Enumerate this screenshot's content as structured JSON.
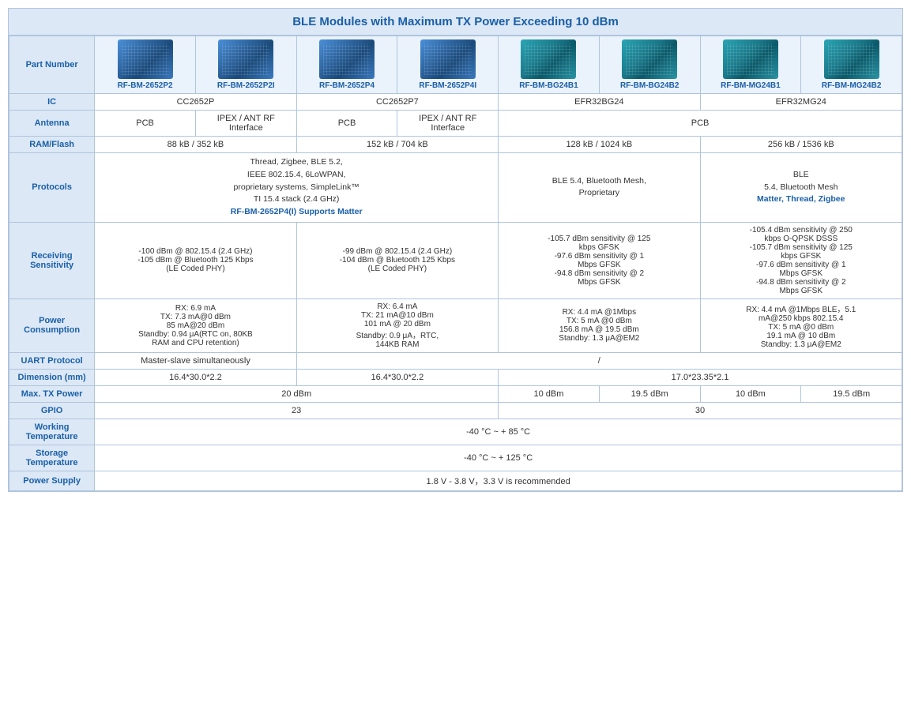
{
  "title": "BLE Modules with Maximum TX Power Exceeding 10 dBm",
  "columns": [
    {
      "id": "RF-BM-2652P2",
      "label": "RF-BM-2652P2",
      "type": "blue"
    },
    {
      "id": "RF-BM-2652P2I",
      "label": "RF-BM-2652P2I",
      "type": "blue"
    },
    {
      "id": "RF-BM-2652P4",
      "label": "RF-BM-2652P4",
      "type": "blue"
    },
    {
      "id": "RF-BM-2652P4I",
      "label": "RF-BM-2652P4I",
      "type": "blue"
    },
    {
      "id": "RF-BM-BG24B1",
      "label": "RF-BM-BG24B1",
      "type": "teal"
    },
    {
      "id": "RF-BM-BG24B2",
      "label": "RF-BM-BG24B2",
      "type": "teal"
    },
    {
      "id": "RF-BM-MG24B1",
      "label": "RF-BM-MG24B1",
      "type": "teal"
    },
    {
      "id": "RF-BM-MG24B2",
      "label": "RF-BM-MG24B2",
      "type": "teal"
    }
  ],
  "rows": {
    "ic": {
      "label": "IC",
      "groups": [
        {
          "span": 2,
          "value": "CC2652P"
        },
        {
          "span": 2,
          "value": "CC2652P7"
        },
        {
          "span": 2,
          "value": "EFR32BG24"
        },
        {
          "span": 2,
          "value": "EFR32MG24"
        }
      ]
    },
    "antenna": {
      "label": "Antenna",
      "groups": [
        {
          "span": 1,
          "value": "PCB"
        },
        {
          "span": 1,
          "value": "IPEX / ANT RF\nInterface"
        },
        {
          "span": 1,
          "value": "PCB"
        },
        {
          "span": 1,
          "value": "IPEX / ANT RF\nInterface"
        },
        {
          "span": 4,
          "value": "PCB"
        }
      ]
    },
    "ram_flash": {
      "label": "RAM/Flash",
      "groups": [
        {
          "span": 2,
          "value": "88 kB / 352 kB"
        },
        {
          "span": 2,
          "value": "152 kB / 704 kB"
        },
        {
          "span": 2,
          "value": "128 kB / 1024 kB"
        },
        {
          "span": 2,
          "value": "256 kB / 1536 kB"
        }
      ]
    },
    "protocols": {
      "label": "Protocols",
      "groups": [
        {
          "span": 4,
          "value": "Thread, Zigbee, BLE 5.2,\nIEEE 802.15.4, 6LoWPAN,\nproprietary systems, SimpleLink™\nTI 15.4 stack (2.4 GHz)",
          "extra": "RF-BM-2652P4(I) Supports Matter"
        },
        {
          "span": 2,
          "value": "BLE 5.4, Bluetooth Mesh,\nProprietaryary"
        },
        {
          "span": 2,
          "value": "BLE\n5.4, Bluetooth Mesh\nMatter, Thread, Zigbee",
          "matter": true
        }
      ]
    },
    "receiving_sensitivity": {
      "label": "Receiving\nSensitivity",
      "groups": [
        {
          "span": 2,
          "value": "-100 dBm @ 802.15.4 (2.4 GHz)\n-105 dBm @ Bluetooth 125 Kbps\n(LE Coded PHY)"
        },
        {
          "span": 2,
          "value": "-99 dBm @ 802.15.4 (2.4 GHz)\n-104 dBm @ Bluetooth 125 Kbps\n(LE Coded PHY)"
        },
        {
          "span": 2,
          "value": "-105.7 dBm sensitivity @ 125 kbps GFSK\n-97.6 dBm sensitivity @ 1 Mbps GFSK\n-94.8 dBm sensitivity @ 2 Mbps GFSK"
        },
        {
          "span": 2,
          "value": "-105.4 dBm sensitivity @ 250 kbps O-QPSK DSSS\n-105.7 dBm sensitivity @ 125 kbps GFSK\n-97.6 dBm sensitivity @ 1 Mbps GFSK\n-94.8 dBm sensitivity @ 2 Mbps GFSK"
        }
      ]
    },
    "power_consumption": {
      "label": "Power\nConsumption",
      "groups": [
        {
          "span": 2,
          "value": "RX: 6.9 mA\nTX: 7.3 mA@0 dBm\n85 mA@20 dBm\nStandby: 0.94 μA(RTC on, 80KB\nRAM and CPU retention)"
        },
        {
          "span": 2,
          "value": "RX: 6.4 mA\nTX: 21 mA@10 dBm\n101 mA @ 20 dBm\nStandby: 0.9 μA，RTC,\n144KB RAM"
        },
        {
          "span": 2,
          "value": "RX: 4.4 mA @1Mbps\nTX: 5 mA @0 dBm\n156.8 mA @ 19.5 dBm\nStandby: 1.3 μA@EM2"
        },
        {
          "span": 2,
          "value": "RX: 4.4 mA @1Mbps BLE，5.1 mA@250 kbps 802.15.4\nTX: 5 mA @0 dBm\n19.1 mA @ 10 dBm\nStandby: 1.3 μA@EM2"
        }
      ]
    },
    "uart_protocol": {
      "label": "UART Protocol",
      "groups": [
        {
          "span": 2,
          "value": "Master-slave simultaneously"
        },
        {
          "span": 6,
          "value": "/"
        }
      ]
    },
    "dimension": {
      "label": "Dimension (mm)",
      "groups": [
        {
          "span": 2,
          "value": "16.4*30.0*2.2"
        },
        {
          "span": 2,
          "value": "16.4*30.0*2.2"
        },
        {
          "span": 4,
          "value": "17.0*23.35*2.1"
        }
      ]
    },
    "max_tx_power": {
      "label": "Max. TX Power",
      "groups": [
        {
          "span": 4,
          "value": "20 dBm"
        },
        {
          "span": 1,
          "value": "10 dBm"
        },
        {
          "span": 1,
          "value": "19.5 dBm"
        },
        {
          "span": 1,
          "value": "10 dBm"
        },
        {
          "span": 1,
          "value": "19.5 dBm"
        }
      ]
    },
    "gpio": {
      "label": "GPIO",
      "groups": [
        {
          "span": 4,
          "value": "23"
        },
        {
          "span": 4,
          "value": "30"
        }
      ]
    },
    "working_temp": {
      "label": "Working\nTemperature",
      "groups": [
        {
          "span": 8,
          "value": "-40 °C ~ + 85 °C"
        }
      ]
    },
    "storage_temp": {
      "label": "Storage\nTemperature",
      "groups": [
        {
          "span": 8,
          "value": "-40 °C ~ + 125 °C"
        }
      ]
    },
    "power_supply": {
      "label": "Power Supply",
      "groups": [
        {
          "span": 8,
          "value": "1.8 V - 3.8 V，3.3 V is recommended"
        }
      ]
    }
  }
}
